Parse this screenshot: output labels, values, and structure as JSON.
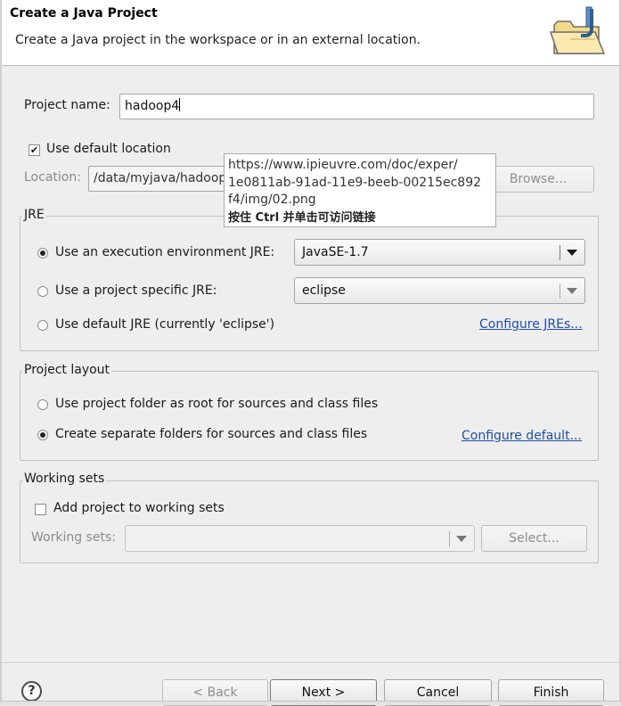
{
  "header": {
    "title": "Create a Java Project",
    "description": "Create a Java project in the workspace or in an external location.",
    "icon": "java-project-folder-icon"
  },
  "project": {
    "name_label": "Project name:",
    "name_value": "hadoop4"
  },
  "location": {
    "use_default_label": "Use default location",
    "use_default_checked": true,
    "label": "Location:",
    "value": "/data/myjava/hadoop4",
    "browse_label": "Browse..."
  },
  "tooltip": {
    "url_line1": "https://www.ipieuvre.com/doc/exper/",
    "url_line2": "1e0811ab-91ad-11e9-beeb-00215ec892",
    "url_line3": "f4/img/02.png",
    "hint": "按住 Ctrl 并单击可访问链接"
  },
  "jre": {
    "group_title": "JRE",
    "option_env": "Use an execution environment JRE:",
    "option_env_value": "JavaSE-1.7",
    "option_specific": "Use a project specific JRE:",
    "option_specific_value": "eclipse",
    "option_default": "Use default JRE (currently 'eclipse')",
    "configure_link": "Configure JREs...",
    "selected": "env"
  },
  "layout": {
    "group_title": "Project layout",
    "option_root": "Use project folder as root for sources and class files",
    "option_separate": "Create separate folders for sources and class files",
    "configure_link": "Configure default...",
    "selected": "separate"
  },
  "working_sets": {
    "group_title": "Working sets",
    "add_label": "Add project to working sets",
    "add_checked": false,
    "sets_label": "Working sets:",
    "sets_value": "",
    "select_label": "Select..."
  },
  "footer": {
    "help_glyph": "?",
    "back_label": "< Back",
    "next_label": "Next >",
    "cancel_label": "Cancel",
    "finish_label": "Finish"
  },
  "colors": {
    "link": "#1f4ea8",
    "disabled_text": "#8a8a8a",
    "dialog_bg": "#eeeeee"
  }
}
